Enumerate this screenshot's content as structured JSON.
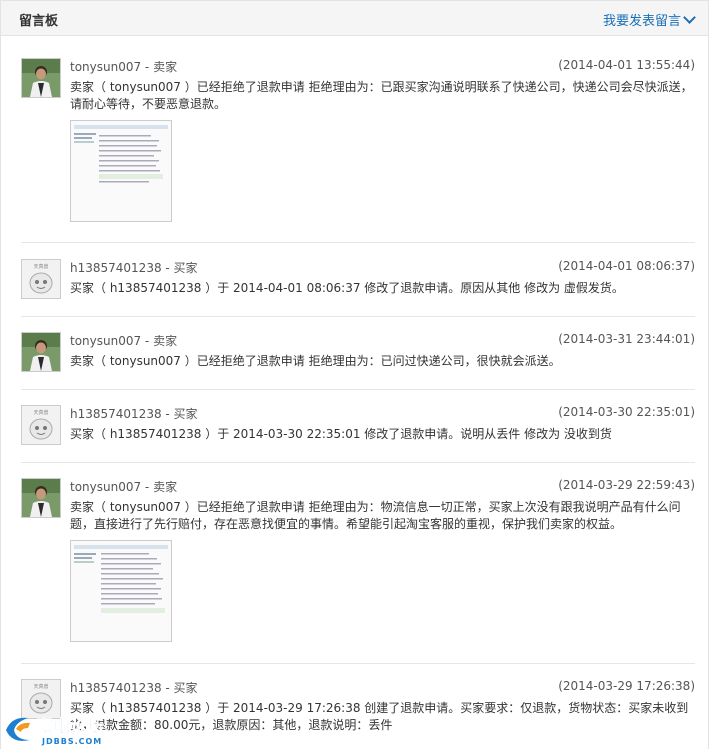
{
  "header": {
    "title": "留言板",
    "post_label": "我要发表留言"
  },
  "messages": [
    {
      "author": "tonysun007 - 卖家",
      "time": "(2014-04-01 13:55:44)",
      "text": "卖家（ tonysun007 ）已经拒绝了退款申请 拒绝理由为：已跟买家沟通说明联系了快递公司，快递公司会尽快派送，请耐心等待，不要恶意退款。",
      "avatar": "seller"
    },
    {
      "author": "h13857401238 - 买家",
      "time": "(2014-04-01 08:06:37)",
      "text": "买家（ h13857401238 ）于 2014-04-01 08:06:37 修改了退款申请。原因从其他 修改为 虚假发货。",
      "avatar": "buyer"
    },
    {
      "author": "tonysun007 - 卖家",
      "time": "(2014-03-31 23:44:01)",
      "text": "卖家（ tonysun007 ）已经拒绝了退款申请 拒绝理由为：已问过快递公司，很快就会派送。",
      "avatar": "seller"
    },
    {
      "author": "h13857401238 - 买家",
      "time": "(2014-03-30 22:35:01)",
      "text": "买家（ h13857401238 ）于 2014-03-30 22:35:01 修改了退款申请。说明从丢件 修改为 没收到货",
      "avatar": "buyer"
    },
    {
      "author": "tonysun007 - 卖家",
      "time": "(2014-03-29 22:59:43)",
      "text": "卖家（ tonysun007 ）已经拒绝了退款申请 拒绝理由为：物流信息一切正常，买家上次没有跟我说明产品有什么问题，直接进行了先行赔付，存在恶意找便宜的事情。希望能引起淘宝客服的重视，保护我们卖家的权益。",
      "avatar": "seller"
    },
    {
      "author": "h13857401238 - 买家",
      "time": "(2014-03-29 17:26:38)",
      "text": "买家（ h13857401238 ）于 2014-03-29 17:26:38 创建了退款申请。买家要求：仅退款，货物状态：买家未收到货，退款金额：80.00元，退款原因：其他，退款说明：丢件",
      "avatar": "buyer"
    }
  ],
  "buyer_avatar_label": "天真兽",
  "watermark": {
    "name": "家电论坛",
    "domain": "JDBBS.COM"
  },
  "colors": {
    "link": "#1a6fb8",
    "header_bg": "#f5f5f5",
    "border": "#e3e3e3"
  }
}
